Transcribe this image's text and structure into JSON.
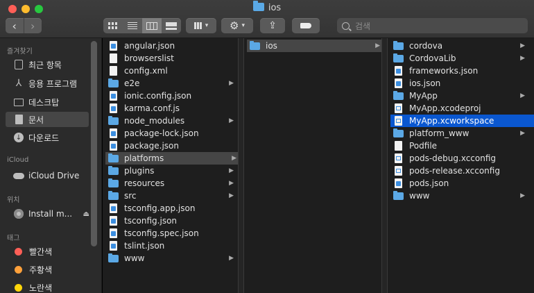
{
  "window": {
    "title": "ios"
  },
  "toolbar": {
    "back_icon": "chevron-left-icon",
    "forward_icon": "chevron-right-icon",
    "search": {
      "placeholder": "검색"
    }
  },
  "sidebar": {
    "sections": [
      {
        "heading": "즐겨찾기",
        "items": [
          {
            "label": "최근 항목",
            "icon": "recents-icon"
          },
          {
            "label": "응용 프로그램",
            "icon": "applications-icon"
          },
          {
            "label": "데스크탑",
            "icon": "desktop-icon"
          },
          {
            "label": "문서",
            "icon": "documents-icon",
            "selected": true
          },
          {
            "label": "다운로드",
            "icon": "downloads-icon"
          }
        ]
      },
      {
        "heading": "iCloud",
        "items": [
          {
            "label": "iCloud Drive",
            "icon": "icloud-icon"
          }
        ]
      },
      {
        "heading": "위치",
        "items": [
          {
            "label": "Install m...",
            "icon": "disk-icon"
          }
        ]
      },
      {
        "heading": "태그",
        "items": [
          {
            "label": "빨간색",
            "color": "#fe5f57"
          },
          {
            "label": "주황색",
            "color": "#ffa13b"
          },
          {
            "label": "노란색",
            "color": "#ffd60a"
          }
        ]
      }
    ]
  },
  "columns": [
    {
      "items": [
        {
          "name": "angular.json",
          "type": "file"
        },
        {
          "name": "browserslist",
          "type": "file"
        },
        {
          "name": "config.xml",
          "type": "file"
        },
        {
          "name": "e2e",
          "type": "folder"
        },
        {
          "name": "ionic.config.json",
          "type": "file"
        },
        {
          "name": "karma.conf.js",
          "type": "file"
        },
        {
          "name": "node_modules",
          "type": "folder"
        },
        {
          "name": "package-lock.json",
          "type": "file"
        },
        {
          "name": "package.json",
          "type": "file"
        },
        {
          "name": "platforms",
          "type": "folder",
          "selected": "gray"
        },
        {
          "name": "plugins",
          "type": "folder"
        },
        {
          "name": "resources",
          "type": "folder"
        },
        {
          "name": "src",
          "type": "folder"
        },
        {
          "name": "tsconfig.app.json",
          "type": "file"
        },
        {
          "name": "tsconfig.json",
          "type": "file"
        },
        {
          "name": "tsconfig.spec.json",
          "type": "file"
        },
        {
          "name": "tslint.json",
          "type": "file"
        },
        {
          "name": "www",
          "type": "folder"
        }
      ]
    },
    {
      "items": [
        {
          "name": "ios",
          "type": "folder",
          "selected": "gray"
        }
      ]
    },
    {
      "items": [
        {
          "name": "cordova",
          "type": "folder"
        },
        {
          "name": "CordovaLib",
          "type": "folder"
        },
        {
          "name": "frameworks.json",
          "type": "file"
        },
        {
          "name": "ios.json",
          "type": "file"
        },
        {
          "name": "MyApp",
          "type": "folder"
        },
        {
          "name": "MyApp.xcodeproj",
          "type": "file"
        },
        {
          "name": "MyApp.xcworkspace",
          "type": "file",
          "selected": "blue"
        },
        {
          "name": "platform_www",
          "type": "folder"
        },
        {
          "name": "Podfile",
          "type": "file"
        },
        {
          "name": "pods-debug.xcconfig",
          "type": "file"
        },
        {
          "name": "pods-release.xcconfig",
          "type": "file"
        },
        {
          "name": "pods.json",
          "type": "file"
        },
        {
          "name": "www",
          "type": "folder"
        }
      ]
    }
  ]
}
